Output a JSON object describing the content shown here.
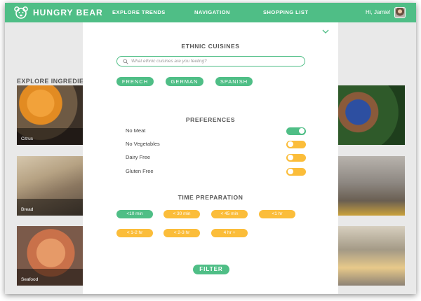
{
  "navbar": {
    "brand": "HUNGRY BEAR",
    "links": [
      "EXPLORE TRENDS",
      "NAVIGATION",
      "SHOPPING LIST"
    ],
    "greeting": "Hi, Jamie!"
  },
  "explore": {
    "title": "EXPLORE INGREDIENTS",
    "tiles": [
      "Citrus",
      "Bread",
      "Seafood"
    ]
  },
  "modal": {
    "cuisines": {
      "title": "ETHNIC CUISINES",
      "search_placeholder": "What ethnic cuisines are you feeling?",
      "chips": [
        "FRENCH",
        "GERMAN",
        "SPANISH"
      ]
    },
    "preferences": {
      "title": "PREFERENCES",
      "items": [
        {
          "label": "No Meat",
          "on": true
        },
        {
          "label": "No Vegetables",
          "on": false
        },
        {
          "label": "Dairy Free",
          "on": false
        },
        {
          "label": "Gluten Free",
          "on": false
        }
      ]
    },
    "time": {
      "title": "TIME PREPARATION",
      "options": [
        {
          "label": "<10 min",
          "selected": true
        },
        {
          "label": "< 30 min",
          "selected": false
        },
        {
          "label": "< 45 min",
          "selected": false
        },
        {
          "label": "<1 hr",
          "selected": false
        },
        {
          "label": "< 1-2 hr",
          "selected": false
        },
        {
          "label": "< 2-3 hr",
          "selected": false
        },
        {
          "label": "4 hr +",
          "selected": false
        }
      ]
    },
    "filter_label": "FILTER"
  },
  "colors": {
    "brand_green": "#4fbe86",
    "accent_yellow": "#fbbd3a"
  },
  "icons": [
    "bear-logo-icon",
    "search-icon",
    "chevron-down-icon"
  ]
}
